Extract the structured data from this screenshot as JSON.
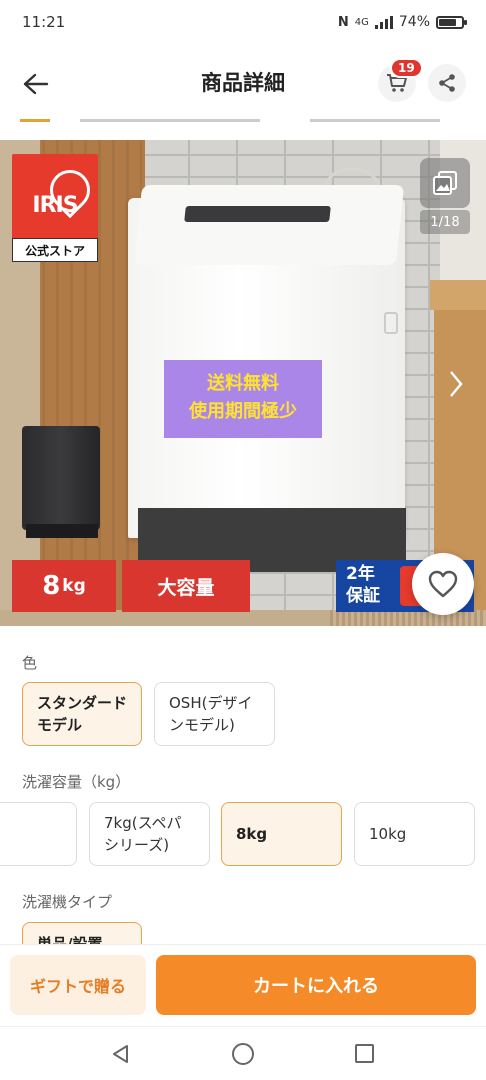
{
  "status_bar": {
    "time": "11:21",
    "network": "4G",
    "battery": "74%"
  },
  "header": {
    "title": "商品詳細",
    "cart_count": "19"
  },
  "image": {
    "brand_logo": "IRIS",
    "official_store": "公式ストア",
    "page_counter": "1/18",
    "promo_line1": "送料無料",
    "promo_line2": "使用期間極少",
    "tag_capacity_value": "8",
    "tag_capacity_unit": "kg",
    "tag_large": "大容量",
    "warranty_line1": "2年",
    "warranty_line2": "保証"
  },
  "options": {
    "color": {
      "label": "色",
      "items": [
        {
          "label": "スタンダードモデル",
          "selected": true
        },
        {
          "label": "OSH(デザインモデル)",
          "selected": false
        }
      ]
    },
    "capacity": {
      "label": "洗濯容量（kg）",
      "items": [
        {
          "label": "",
          "selected": false
        },
        {
          "label": "7kg(スペパシリーズ)",
          "selected": false
        },
        {
          "label": "8kg",
          "selected": true
        },
        {
          "label": "10kg",
          "selected": false
        }
      ]
    },
    "type": {
      "label": "洗濯機タイプ",
      "items": [
        {
          "label": "単品/設置",
          "selected": true
        }
      ]
    }
  },
  "actions": {
    "gift": "ギフトで贈る",
    "add_to_cart": "カートに入れる"
  },
  "colors": {
    "accent": "#f58b28",
    "badge": "#e0342f",
    "selected_border": "#e7a44f"
  }
}
